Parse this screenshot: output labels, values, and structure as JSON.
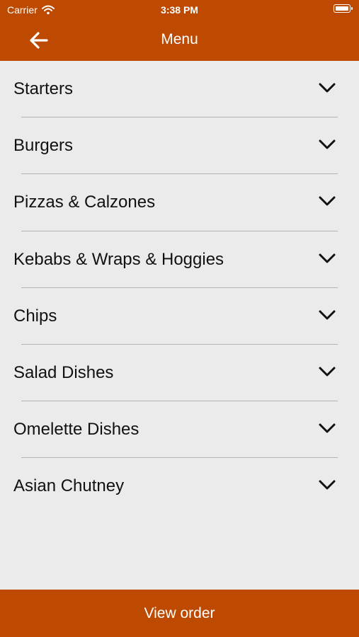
{
  "status_bar": {
    "carrier": "Carrier",
    "time": "3:38 PM"
  },
  "header": {
    "title": "Menu",
    "back_icon": "arrow-left-icon"
  },
  "menu": {
    "items": [
      {
        "label": "Starters"
      },
      {
        "label": "Burgers"
      },
      {
        "label": "Pizzas & Calzones"
      },
      {
        "label": "Kebabs & Wraps & Hoggies"
      },
      {
        "label": "Chips"
      },
      {
        "label": "Salad Dishes"
      },
      {
        "label": "Omelette Dishes"
      },
      {
        "label": "Asian Chutney"
      }
    ]
  },
  "footer": {
    "view_order_label": "View order"
  },
  "colors": {
    "brand": "#bd4a00",
    "background": "#ebebeb",
    "divider": "#b3b3b3"
  }
}
